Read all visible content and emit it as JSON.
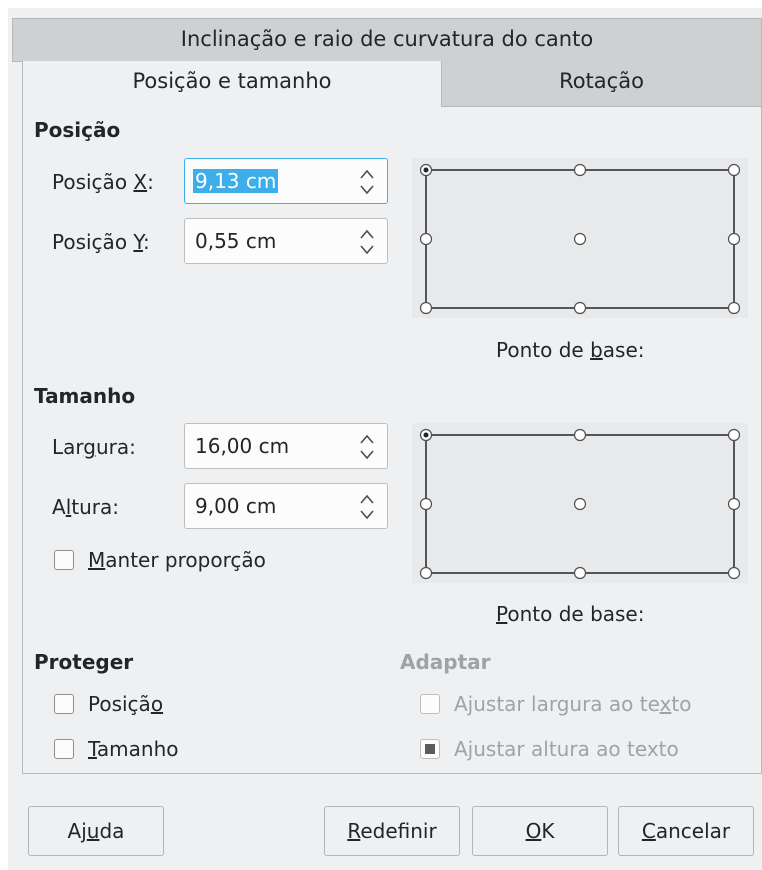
{
  "tabs": {
    "top_row": "Inclinação e raio de curvatura do canto",
    "active": "Posição e tamanho",
    "inactive": "Rotação"
  },
  "position": {
    "heading": "Posição",
    "x_label_pre": "Posição ",
    "x_label_acc": "X",
    "x_label_post": ":",
    "x_value": "9,13 cm",
    "y_label_pre": "Posição ",
    "y_label_acc": "Y",
    "y_label_post": ":",
    "y_value": "0,55 cm",
    "base_point_pre": "Ponto de ",
    "base_point_acc": "b",
    "base_point_post": "ase:"
  },
  "size": {
    "heading": "Tamanho",
    "width_label_pre": "Lar",
    "width_label_acc": "g",
    "width_label_post": "ura:",
    "width_value": "16,00 cm",
    "height_label_pre": "A",
    "height_label_acc": "l",
    "height_label_post": "tura:",
    "height_value": "9,00 cm",
    "keep_ratio_acc": "M",
    "keep_ratio_post": "anter proporção",
    "base_point_acc": "P",
    "base_point_post": "onto de base:"
  },
  "protect": {
    "heading": "Proteger",
    "position_pre": "Posiçã",
    "position_acc": "o",
    "size_acc": "T",
    "size_post": "amanho"
  },
  "adapt": {
    "heading": "Adaptar",
    "fit_width_pre": "Ajustar largura ao te",
    "fit_width_acc": "x",
    "fit_width_post": "to",
    "fit_height": "Ajustar altura ao texto",
    "fit_height_checked": true
  },
  "buttons": {
    "help_pre": "Aj",
    "help_acc": "u",
    "help_post": "da",
    "reset_acc": "R",
    "reset_post": "edefinir",
    "ok_acc": "O",
    "ok_post": "K",
    "cancel_acc": "C",
    "cancel_post": "ancelar"
  },
  "colors": {
    "accent": "#3daee9",
    "dialog_bg": "#eff0f1",
    "tab_inactive_bg": "#cfd0d1"
  }
}
